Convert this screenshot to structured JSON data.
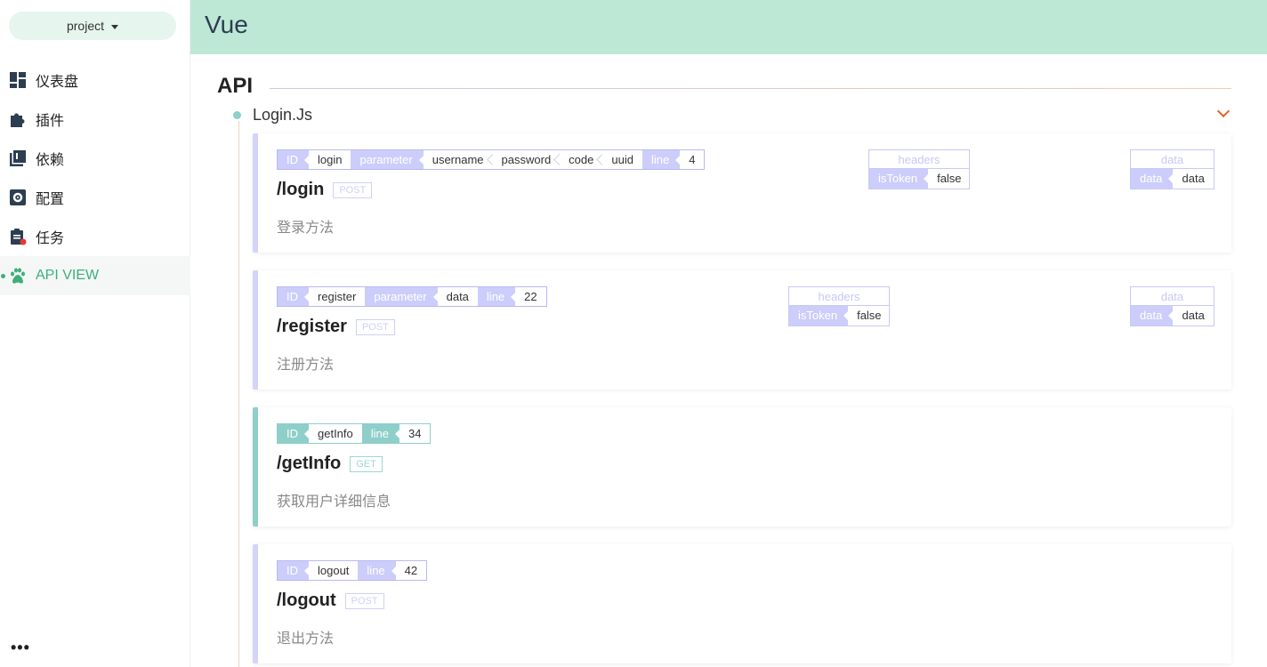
{
  "sidebar": {
    "project": "project",
    "items": [
      {
        "label": "仪表盘",
        "icon": "dashboard-icon"
      },
      {
        "label": "插件",
        "icon": "puzzle-icon"
      },
      {
        "label": "依赖",
        "icon": "library-icon"
      },
      {
        "label": "配置",
        "icon": "settings-icon"
      },
      {
        "label": "任务",
        "icon": "clipboard-icon"
      },
      {
        "label": "API VIEW",
        "icon": "paw-icon",
        "active": true
      }
    ],
    "more": "•••"
  },
  "header": {
    "title": "Vue"
  },
  "main": {
    "section_title": "API",
    "file": "Login.Js",
    "endpoints": [
      {
        "id_key": "ID",
        "id": "login",
        "param_key": "parameter",
        "params": [
          "username",
          "password",
          "code",
          "uuid"
        ],
        "line_key": "line",
        "line": "4",
        "path": "/login",
        "method": "POST",
        "desc": "登录方法",
        "headers_title": "headers",
        "headers_key": "isToken",
        "headers_value": "false",
        "data_title": "data",
        "data_key": "data",
        "data_value": "data"
      },
      {
        "id_key": "ID",
        "id": "register",
        "param_key": "parameter",
        "params": [
          "data"
        ],
        "line_key": "line",
        "line": "22",
        "path": "/register",
        "method": "POST",
        "desc": "注册方法",
        "headers_title": "headers",
        "headers_key": "isToken",
        "headers_value": "false",
        "data_title": "data",
        "data_key": "data",
        "data_value": "data"
      },
      {
        "id_key": "ID",
        "id": "getInfo",
        "line_key": "line",
        "line": "34",
        "path": "/getInfo",
        "method": "GET",
        "desc": "获取用户详细信息"
      },
      {
        "id_key": "ID",
        "id": "logout",
        "line_key": "line",
        "line": "42",
        "path": "/logout",
        "method": "POST",
        "desc": "退出方法"
      }
    ]
  },
  "colors": {
    "accent": "#3eaf7c",
    "header_bg": "#bde8d6",
    "post": "#cdcdfb",
    "get": "#8ecfc9",
    "chevron": "#e8602c"
  }
}
